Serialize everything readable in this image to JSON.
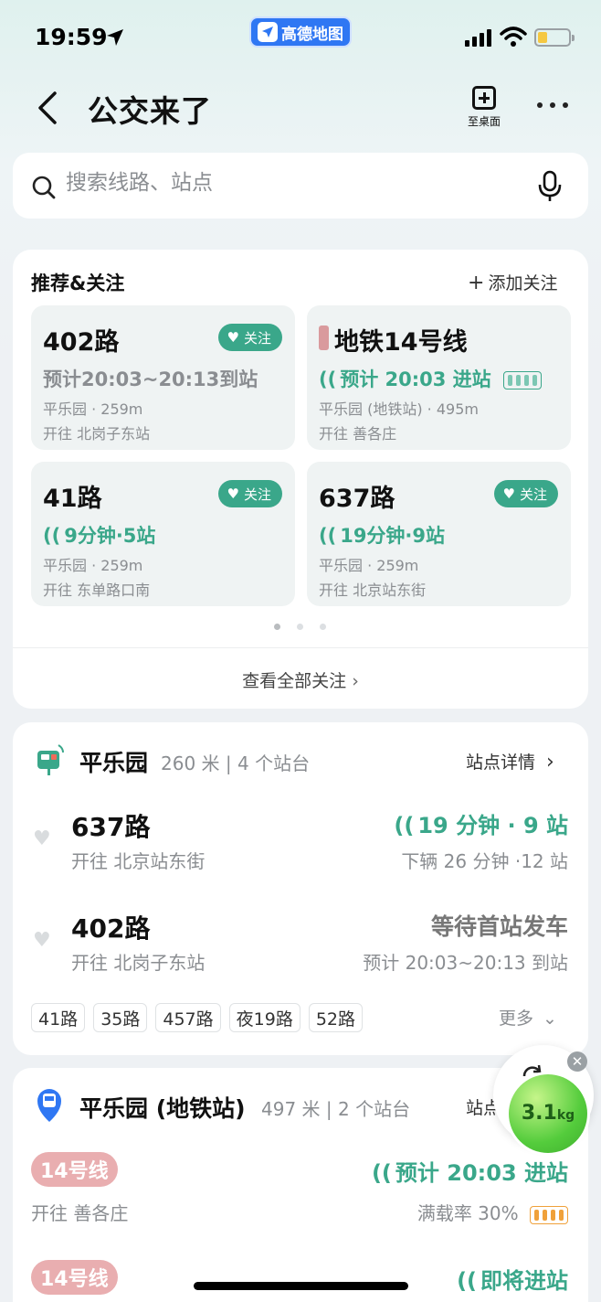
{
  "status": {
    "time": "19:59",
    "app_name": "高德地图"
  },
  "header": {
    "title": "公交来了",
    "desktop_label": "至桌面"
  },
  "search": {
    "placeholder": "搜索线路、站点"
  },
  "recommend": {
    "title": "推荐&关注",
    "add_label": "添加关注",
    "follow_label": "关注",
    "tiles": [
      {
        "name": "402路",
        "eta": "预计20:03~20:13到站",
        "stop": "平乐园 · 259m",
        "dir": "开往 北岗子东站"
      },
      {
        "name": "地铁14号线",
        "eta": "预计 20:03 进站",
        "stop": "平乐园 (地铁站) · 495m",
        "dir": "开往 善各庄"
      },
      {
        "name": "41路",
        "eta": "9分钟·5站",
        "stop": "平乐园 · 259m",
        "dir": "开往 东单路口南"
      },
      {
        "name": "637路",
        "eta": "19分钟·9站",
        "stop": "平乐园 · 259m",
        "dir": "开往 北京站东街"
      }
    ],
    "view_all": "查看全部关注"
  },
  "station1": {
    "name": "平乐园",
    "meta": "260 米 | 4 个站台",
    "detail": "站点详情",
    "lines": [
      {
        "name": "637路",
        "dir": "开往 北京站东街",
        "eta": "19 分钟 · 9 站",
        "next": "下辆 26 分钟 ·12 站"
      },
      {
        "name": "402路",
        "dir": "开往 北岗子东站",
        "eta": "等待首站发车",
        "next": "预计 20:03~20:13 到站"
      }
    ],
    "chips": [
      "41路",
      "35路",
      "457路",
      "夜19路",
      "52路"
    ],
    "more": "更多"
  },
  "station2": {
    "name": "平乐园 (地铁站)",
    "meta": "497 米 | 2 个站台",
    "detail": "站点",
    "lines": [
      {
        "badge": "14号线",
        "dir": "开往 善各庄",
        "eta": "预计 20:03 进站",
        "load": "满载率 30%"
      },
      {
        "badge": "14号线",
        "eta": "即将进站"
      }
    ]
  },
  "float": {
    "kg_value": "3.1",
    "kg_unit": "kg"
  },
  "colors": {
    "accent": "#3aa78a",
    "subway14": "#e9aeb0",
    "grey": "#8a8d91"
  }
}
